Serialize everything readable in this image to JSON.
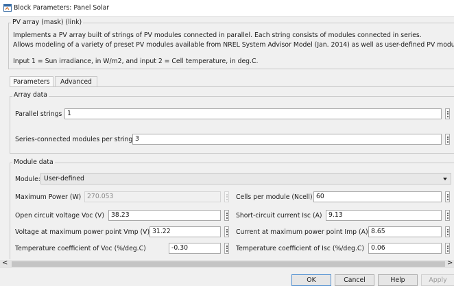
{
  "window": {
    "title": "Block Parameters: Panel Solar"
  },
  "mask": {
    "legend": "PV array (mask) (link)",
    "description_line1": "Implements a PV array built of strings of PV modules connected in parallel. Each string consists of modules connected in series.",
    "description_line2": "Allows modeling of a variety of preset PV modules available from NREL System Advisor Model (Jan. 2014) as well as user-defined PV module.",
    "description_line3": "Input 1 = Sun irradiance, in W/m2, and input 2 = Cell temperature, in deg.C."
  },
  "tabs": [
    {
      "label": "Parameters",
      "active": true
    },
    {
      "label": "Advanced",
      "active": false
    }
  ],
  "array_data": {
    "legend": "Array data",
    "parallel_strings": {
      "label": "Parallel strings",
      "value": "1"
    },
    "series_modules": {
      "label": "Series-connected modules per string",
      "value": "3"
    }
  },
  "module_data": {
    "legend": "Module data",
    "module": {
      "label": "Module:",
      "value": "User-defined"
    },
    "max_power": {
      "label": "Maximum Power (W)",
      "value": "270.053"
    },
    "cells_per_module": {
      "label": "Cells per module (Ncell)",
      "value": "60"
    },
    "voc": {
      "label": "Open circuit voltage  Voc (V)",
      "value": "38.23"
    },
    "isc": {
      "label": "Short-circuit current Isc (A)",
      "value": "9.13"
    },
    "vmp": {
      "label": "Voltage at maximum power point Vmp (V)",
      "value": "31.22"
    },
    "imp": {
      "label": "Current at maximum power point Imp (A)",
      "value": "8.65"
    },
    "temp_coeff_voc": {
      "label": "Temperature coefficient of Voc (%/deg.C)",
      "value": "-0.30"
    },
    "temp_coeff_isc": {
      "label": "Temperature coefficient of Isc (%/deg.C)",
      "value": "0.06"
    }
  },
  "scrollbar": {
    "left_arrow": "<",
    "right_arrow": ">"
  },
  "buttons": {
    "ok": "OK",
    "cancel": "Cancel",
    "help": "Help",
    "apply": "Apply"
  },
  "colors": {
    "primary_button_border": "#4f8fd0",
    "input_border": "#a9a9a9",
    "background": "#f0f0f0"
  }
}
